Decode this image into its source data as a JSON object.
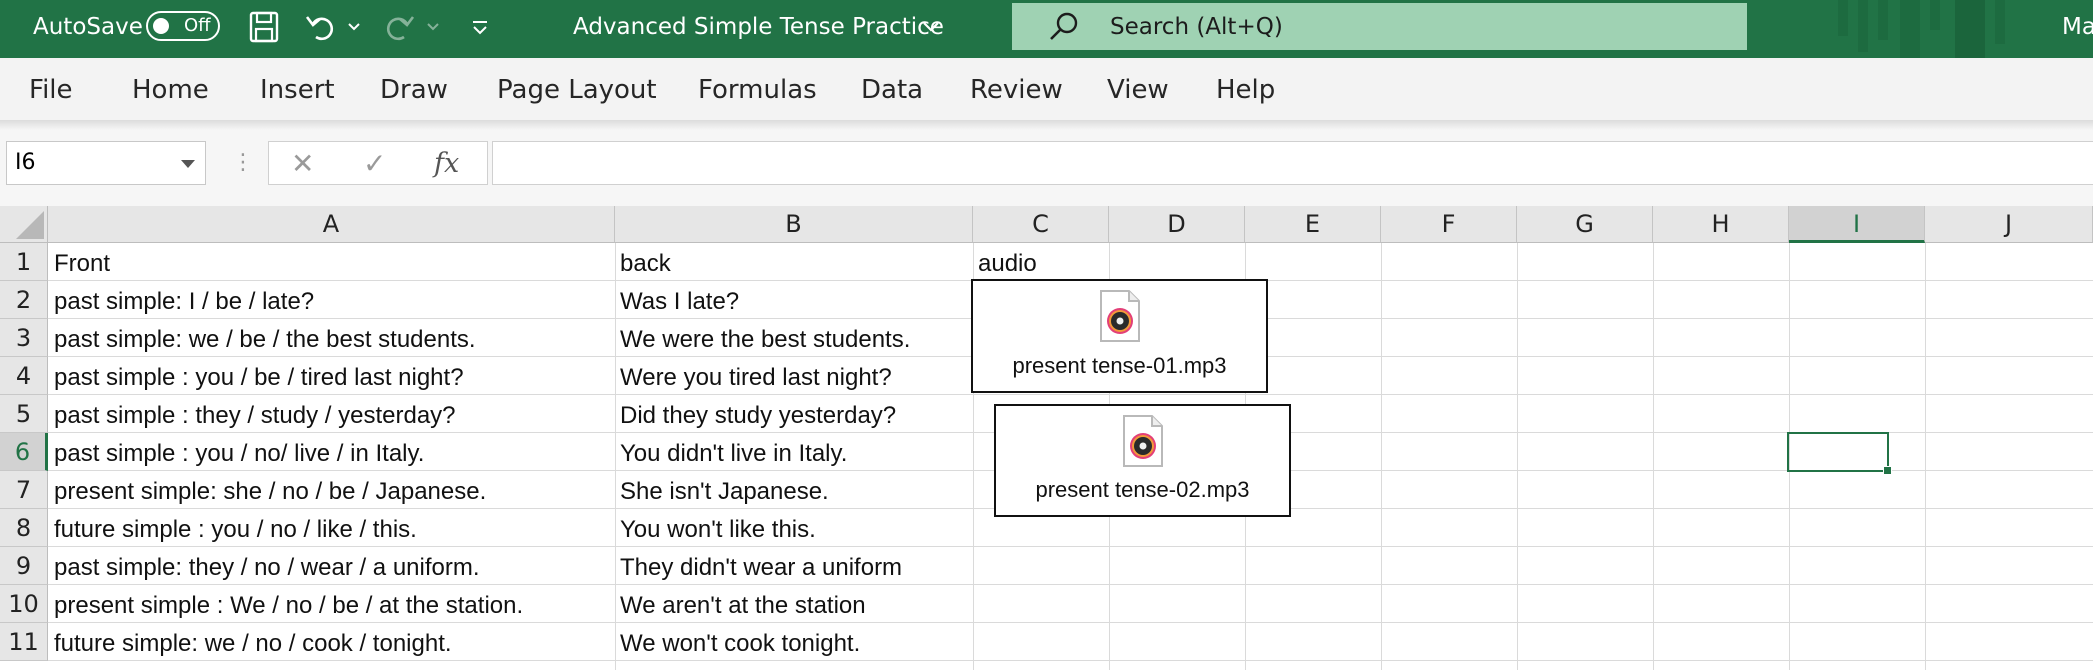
{
  "titlebar": {
    "autosave_label": "AutoSave",
    "autosave_state": "Off",
    "doc_title": "Advanced Simple Tense Practice",
    "search_placeholder": "Search (Alt+Q)",
    "user_initials": "Ma",
    "bg_color": "#217346"
  },
  "menu": {
    "items": [
      "File",
      "Home",
      "Insert",
      "Draw",
      "Page Layout",
      "Formulas",
      "Data",
      "Review",
      "View",
      "Help"
    ]
  },
  "formula_bar": {
    "name_box": "I6",
    "formula": ""
  },
  "grid": {
    "columns": [
      "A",
      "B",
      "C",
      "D",
      "E",
      "F",
      "G",
      "H",
      "I",
      "J"
    ],
    "selected_column": "I",
    "rows": [
      "1",
      "2",
      "3",
      "4",
      "5",
      "6",
      "7",
      "8",
      "9",
      "10",
      "11"
    ],
    "selected_row": "6",
    "data": [
      [
        "Front",
        "back",
        "audio"
      ],
      [
        "past simple: I / be / late?",
        "Was I late?",
        ""
      ],
      [
        "past simple: we / be / the best students.",
        "We were the best students.",
        ""
      ],
      [
        "past simple : you / be / tired last night?",
        "Were you tired last night?",
        ""
      ],
      [
        "past simple : they / study / yesterday?",
        "Did they study yesterday?",
        ""
      ],
      [
        "past simple : you / no/  live / in Italy.",
        "You didn't live in Italy.",
        ""
      ],
      [
        "present simple: she / no /  be / Japanese.",
        "She isn't Japanese.",
        ""
      ],
      [
        "future simple : you / no /  like / this.",
        "You won't like this.",
        ""
      ],
      [
        "past simple: they / no / wear / a uniform.",
        "They didn't wear a uniform",
        ""
      ],
      [
        "present simple : We / no / be / at the station.",
        "We aren't at the station",
        ""
      ],
      [
        "future simple: we / no /  cook / tonight.",
        "We won't cook tonight.",
        ""
      ]
    ]
  },
  "attachments": [
    {
      "filename": "present tense-01.mp3",
      "icon": "audio-file-icon"
    },
    {
      "filename": "present tense-02.mp3",
      "icon": "audio-file-icon"
    }
  ]
}
